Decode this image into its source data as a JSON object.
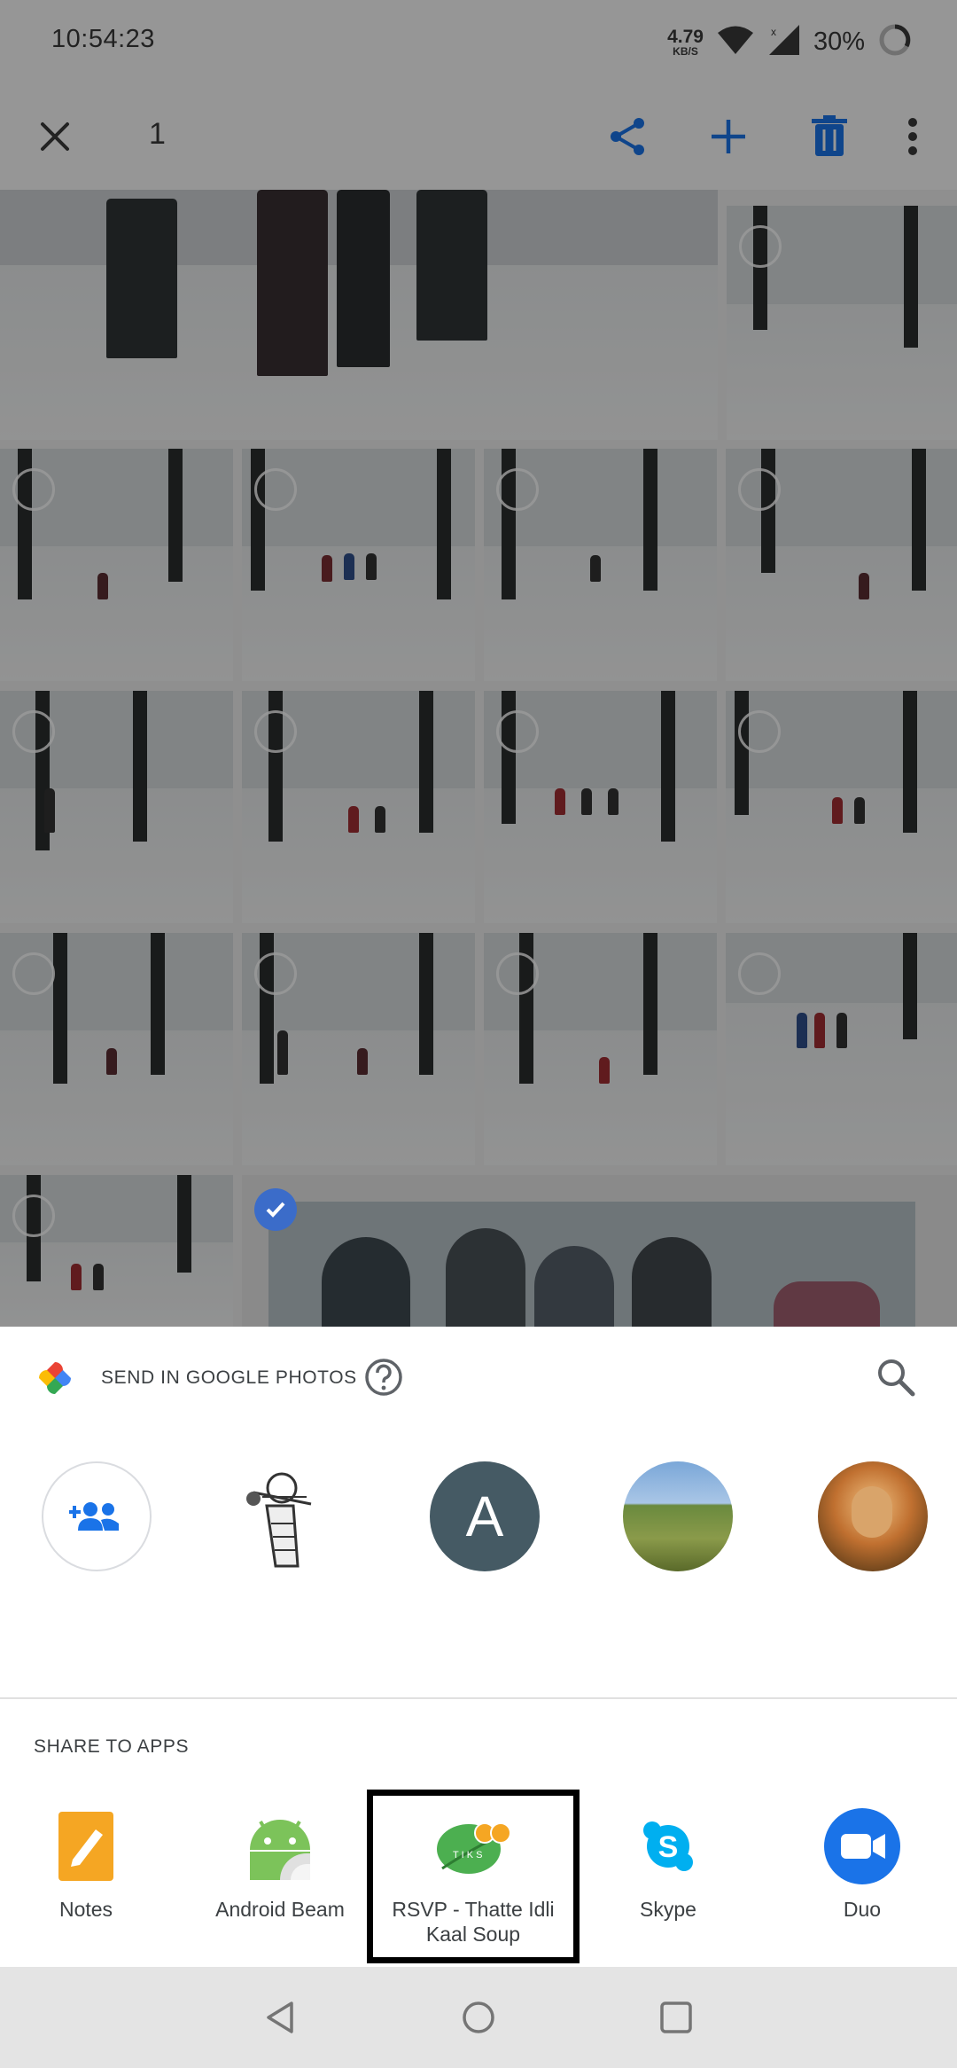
{
  "status_bar": {
    "time": "10:54:23",
    "net_speed_value": "4.79",
    "net_speed_unit": "KB/S",
    "battery": "30%",
    "icons": [
      "wifi-icon",
      "signal-icon",
      "battery-icon"
    ]
  },
  "top_bar": {
    "selected_count": "1",
    "actions": [
      "close-icon",
      "share-icon",
      "add-icon",
      "delete-icon",
      "more-vert-icon"
    ],
    "accent_color": "#1a73e8"
  },
  "photo_grid": {
    "rows": 5,
    "selected_tile": "group-selfie"
  },
  "sheet": {
    "title": "SEND IN GOOGLE PHOTOS",
    "contacts": [
      {
        "kind": "add-group",
        "icon": "group-add-icon"
      },
      {
        "kind": "sketch"
      },
      {
        "kind": "initial",
        "initial": "A"
      },
      {
        "kind": "landscape"
      },
      {
        "kind": "portrait"
      }
    ],
    "share_title": "SHARE TO APPS",
    "apps": [
      {
        "label": "Notes",
        "icon": "notes-icon",
        "color": "#f5a623"
      },
      {
        "label": "Android Beam",
        "icon": "android-icon",
        "color": "#7cc35a"
      },
      {
        "label": "RSVP - Thatte Idli Kaal Soup",
        "icon": "leaf-icon",
        "color": "#4caf50"
      },
      {
        "label": "Skype",
        "icon": "skype-icon",
        "color": "#00aff0"
      },
      {
        "label": "Duo",
        "icon": "video-icon",
        "color": "#1a73e8"
      }
    ]
  },
  "nav_bar": {
    "buttons": [
      "back-icon",
      "home-icon",
      "recents-icon"
    ]
  }
}
